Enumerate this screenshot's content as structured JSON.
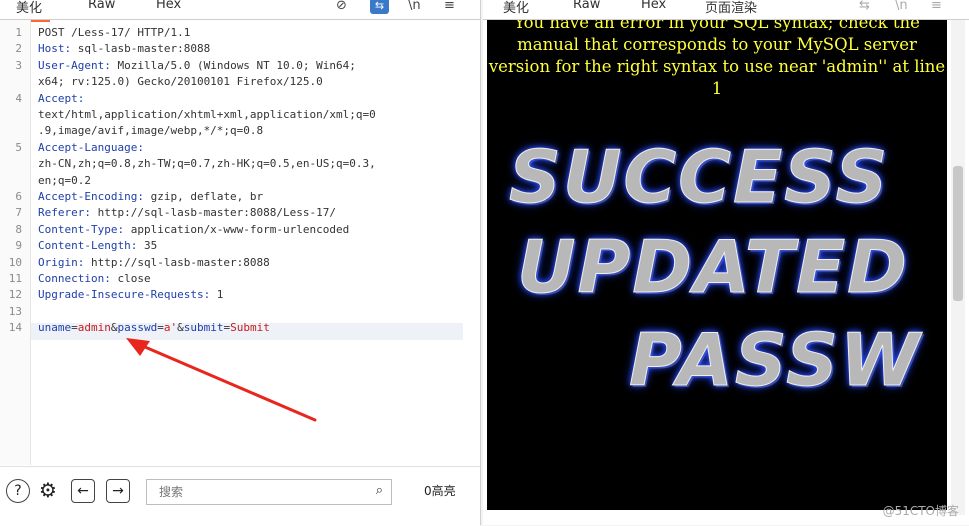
{
  "left": {
    "tabs": [
      "美化",
      "Raw",
      "Hex"
    ],
    "lines": [
      {
        "n": "1",
        "segs": [
          [
            "POST /Less-17/ HTTP/1.1",
            ""
          ]
        ]
      },
      {
        "n": "2",
        "segs": [
          [
            "Host:",
            "hk"
          ],
          [
            " sql-lasb-master:8088",
            ""
          ]
        ]
      },
      {
        "n": "3",
        "segs": [
          [
            "User-Agent:",
            "hk"
          ],
          [
            " Mozilla/5.0 (Windows NT 10.0; Win64;",
            ""
          ]
        ]
      },
      {
        "n": "",
        "segs": [
          [
            "x64; rv:125.0) Gecko/20100101 Firefox/125.0",
            ""
          ]
        ]
      },
      {
        "n": "4",
        "segs": [
          [
            "Accept:",
            "hk"
          ]
        ]
      },
      {
        "n": "",
        "segs": [
          [
            "text/html,application/xhtml+xml,application/xml;q=0",
            ""
          ]
        ]
      },
      {
        "n": "",
        "segs": [
          [
            ".9,image/avif,image/webp,*/*;q=0.8",
            ""
          ]
        ]
      },
      {
        "n": "5",
        "segs": [
          [
            "Accept-Language:",
            "hk"
          ]
        ]
      },
      {
        "n": "",
        "segs": [
          [
            "zh-CN,zh;q=0.8,zh-TW;q=0.7,zh-HK;q=0.5,en-US;q=0.3,",
            ""
          ]
        ]
      },
      {
        "n": "",
        "segs": [
          [
            "en;q=0.2",
            ""
          ]
        ]
      },
      {
        "n": "6",
        "segs": [
          [
            "Accept-Encoding:",
            "hk"
          ],
          [
            " gzip, deflate, br",
            ""
          ]
        ]
      },
      {
        "n": "7",
        "segs": [
          [
            "Referer:",
            "hk"
          ],
          [
            " http://sql-lasb-master:8088/Less-17/",
            ""
          ]
        ]
      },
      {
        "n": "8",
        "segs": [
          [
            "Content-Type:",
            "hk"
          ],
          [
            " application/x-www-form-urlencoded",
            ""
          ]
        ]
      },
      {
        "n": "9",
        "segs": [
          [
            "Content-Length:",
            "hk"
          ],
          [
            " 35",
            ""
          ]
        ]
      },
      {
        "n": "10",
        "segs": [
          [
            "Origin:",
            "hk"
          ],
          [
            " http://sql-lasb-master:8088",
            ""
          ]
        ]
      },
      {
        "n": "11",
        "segs": [
          [
            "Connection:",
            "hk"
          ],
          [
            " close",
            ""
          ]
        ]
      },
      {
        "n": "12",
        "segs": [
          [
            "Upgrade-Insecure-Requests:",
            "hk"
          ],
          [
            " 1",
            ""
          ]
        ]
      },
      {
        "n": "13",
        "segs": []
      },
      {
        "n": "14",
        "segs": [
          [
            "uname",
            "blue"
          ],
          [
            "=",
            ""
          ],
          [
            "admin",
            "red"
          ],
          [
            "&",
            ""
          ],
          [
            "passwd",
            "blue"
          ],
          [
            "=",
            ""
          ],
          [
            "a'",
            "red"
          ],
          [
            "&",
            ""
          ],
          [
            "submit",
            "blue"
          ],
          [
            "=",
            ""
          ],
          [
            "Submit",
            "red"
          ]
        ]
      }
    ],
    "search_placeholder": "搜索",
    "highlights": "0高亮"
  },
  "right": {
    "tabs": [
      "美化",
      "Raw",
      "Hex",
      "页面渲染"
    ],
    "error_text": "You have an error in your SQL syntax; check the manual that corresponds to your MySQL server version for the right syntax to use near 'admin'' at line 1",
    "banner": [
      "SUCCESS",
      "UPDATED",
      "PASSW"
    ]
  },
  "watermark": "@51CTO博客",
  "colors": {
    "accent": "#ff6633",
    "header_key": "#1f3fa8",
    "param_value": "#c81e1e",
    "error_text": "#ffff3a",
    "arrow": "#e8261e"
  }
}
